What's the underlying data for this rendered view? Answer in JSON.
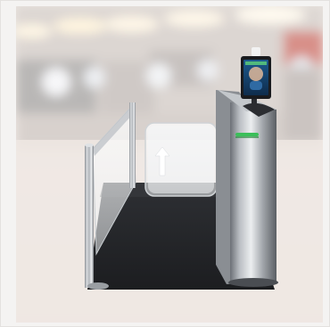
{
  "scene": {
    "background": "blurred-airport-terminal",
    "subject": "security-swing-gate-turnstile",
    "device": "face-recognition-temperature-terminal",
    "direction_indicator": "arrow-up-icon",
    "indicator_color": "#ffffff",
    "accent_color": "#3bbf5a"
  }
}
